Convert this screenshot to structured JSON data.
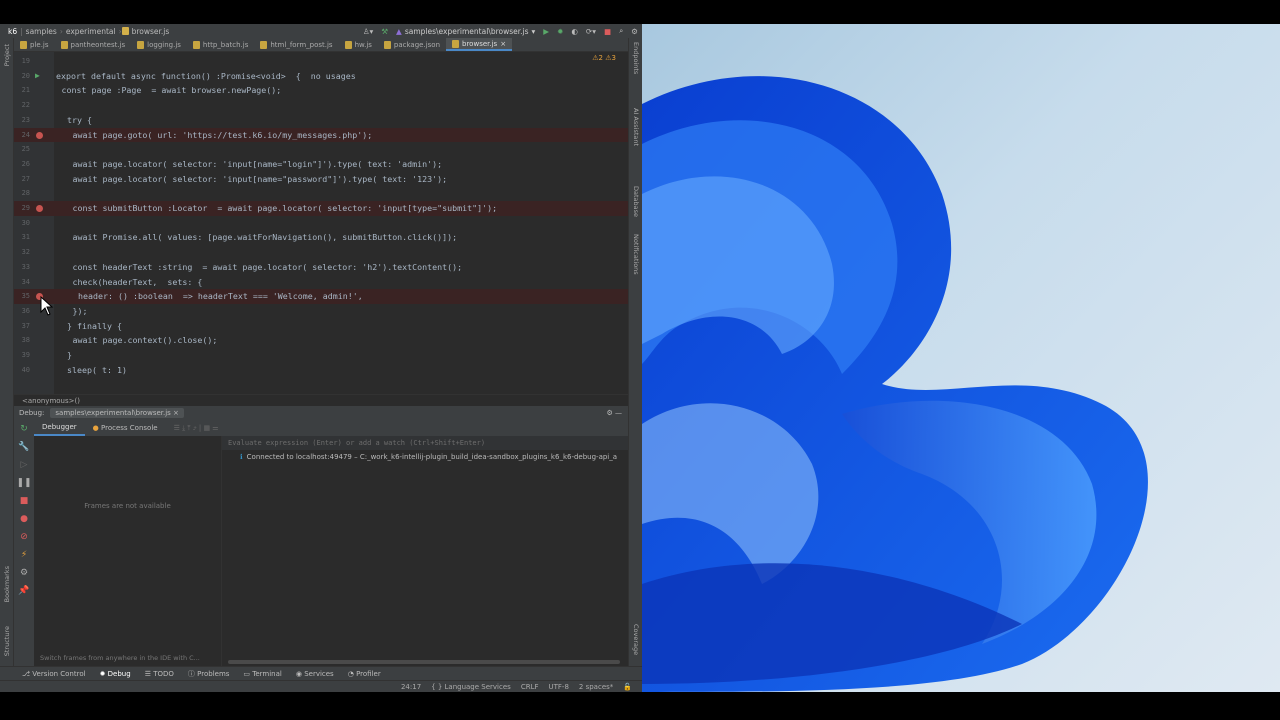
{
  "title": {
    "crumbs": [
      "k6",
      "samples",
      "experimental",
      "browser.js"
    ],
    "run_config": "samples\\experimental\\browser.js"
  },
  "tabs": [
    "ple.js",
    "pantheontest.js",
    "logging.js",
    "http_batch.js",
    "html_form_post.js",
    "hw.js",
    "package.json",
    "browser.js"
  ],
  "left_strip": {
    "project": "Project",
    "bookmarks": "Bookmarks",
    "structure": "Structure"
  },
  "right_strip": [
    "Endpoints",
    "AI Assistant",
    "Database",
    "Notifications",
    "Coverage"
  ],
  "warnings": {
    "warn": "2",
    "weak": "3"
  },
  "editor": {
    "lines": [
      {
        "n": "19",
        "html": ""
      },
      {
        "n": "20",
        "html": "export default async function() :Promise<void>  {  no usages"
      },
      {
        "n": "21",
        "html": "const page :Page  = await browser.newPage();"
      },
      {
        "n": "22",
        "html": ""
      },
      {
        "n": "23",
        "html": "try {"
      },
      {
        "n": "24",
        "html": "await page.goto( url: 'https://test.k6.io/my_messages.php');"
      },
      {
        "n": "25",
        "html": ""
      },
      {
        "n": "26",
        "html": "await page.locator( selector: 'input[name=\"login\"]').type( text: 'admin');"
      },
      {
        "n": "27",
        "html": "await page.locator( selector: 'input[name=\"password\"]').type( text: '123');"
      },
      {
        "n": "28",
        "html": ""
      },
      {
        "n": "29",
        "html": "const submitButton :Locator  = await page.locator( selector: 'input[type=\"submit\"]');"
      },
      {
        "n": "30",
        "html": ""
      },
      {
        "n": "31",
        "html": "await Promise.all( values: [page.waitForNavigation(), submitButton.click()]);"
      },
      {
        "n": "32",
        "html": ""
      },
      {
        "n": "33",
        "html": "const headerText :string  = await page.locator( selector: 'h2').textContent();"
      },
      {
        "n": "34",
        "html": "check(headerText,  sets: {"
      },
      {
        "n": "35",
        "html": "header: () :boolean  => headerText === 'Welcome, admin!',"
      },
      {
        "n": "36",
        "html": "});"
      },
      {
        "n": "37",
        "html": "} finally {"
      },
      {
        "n": "38",
        "html": "await page.context().close();"
      },
      {
        "n": "39",
        "html": "}"
      },
      {
        "n": "40",
        "html": "sleep( t: 1)"
      }
    ]
  },
  "breadcrumb": "<anonymous>()",
  "debug": {
    "label": "Debug:",
    "config": "samples\\experimental\\browser.js",
    "tab_debugger": "Debugger",
    "tab_console": "Process Console",
    "frames_empty": "Frames are not available",
    "frames_tip": "Switch frames from anywhere in the IDE with C...",
    "eval_placeholder": "Evaluate expression (Enter) or add a watch (Ctrl+Shift+Enter)",
    "connected": "Connected to localhost:49479 – C:_work_k6-intellij-plugin_build_idea-sandbox_plugins_k6_k6-debug-api_a"
  },
  "toolwindows": [
    "Version Control",
    "Debug",
    "TODO",
    "Problems",
    "Terminal",
    "Services",
    "Profiler"
  ],
  "status": {
    "pos": "24:17",
    "lang": "Language Services",
    "eol": "CRLF",
    "enc": "UTF-8",
    "indent": "2 spaces*"
  }
}
